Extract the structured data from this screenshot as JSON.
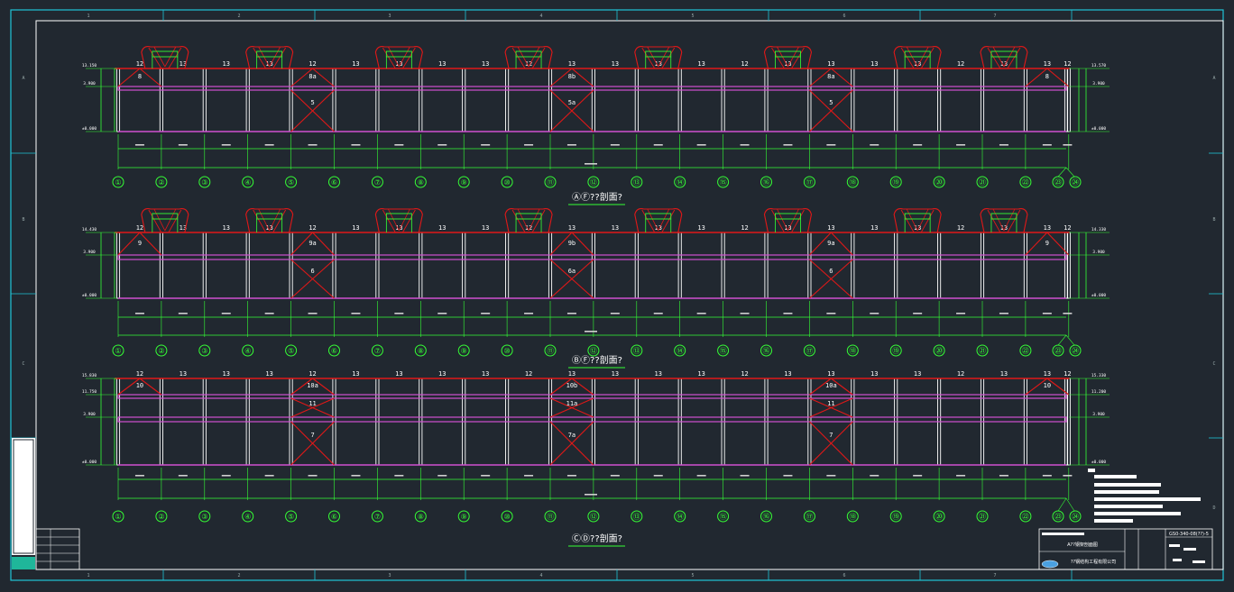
{
  "sections": [
    {
      "key": "af",
      "title": "ⒶⒻ??剖面?",
      "top_codes": [
        "12",
        "13",
        "13",
        "13",
        "12",
        "13",
        "13",
        "13",
        "13",
        "12",
        "13",
        "13",
        "13",
        "13",
        "12",
        "13",
        "13",
        "13",
        "13",
        "12",
        "13",
        "13",
        "12"
      ],
      "braces": [
        {
          "bay": 1,
          "top": "8"
        },
        {
          "bay": 5,
          "top": "8a",
          "bottom": "5"
        },
        {
          "bay": 11,
          "top": "8b",
          "bottom": "5a"
        },
        {
          "bay": 17,
          "top": "8a",
          "bottom": "5"
        },
        {
          "bay": 22,
          "top": "8"
        }
      ],
      "left_elevations": [
        "13.150",
        "3.900",
        "±0.000"
      ],
      "right_elevations": [
        "13.570",
        "3.900",
        "±0.000"
      ],
      "grid_labels": [
        "①",
        "②",
        "③",
        "④",
        "⑤",
        "⑥",
        "⑦",
        "⑧",
        "⑨",
        "⑩",
        "⑪",
        "⑫",
        "⑬",
        "⑭",
        "⑮",
        "⑯",
        "⑰",
        "⑱",
        "⑲",
        "⑳",
        "㉑",
        "㉒",
        "㉓",
        "㉔"
      ]
    },
    {
      "key": "bf",
      "title": "ⒷⒻ??剖面?",
      "top_codes": [
        "12",
        "13",
        "13",
        "13",
        "12",
        "13",
        "13",
        "13",
        "13",
        "12",
        "13",
        "13",
        "13",
        "13",
        "12",
        "13",
        "13",
        "13",
        "13",
        "12",
        "13",
        "13",
        "12"
      ],
      "braces": [
        {
          "bay": 1,
          "top": "9"
        },
        {
          "bay": 5,
          "top": "9a",
          "bottom": "6"
        },
        {
          "bay": 11,
          "top": "9b",
          "bottom": "6a"
        },
        {
          "bay": 17,
          "top": "9a",
          "bottom": "6"
        },
        {
          "bay": 22,
          "top": "9"
        }
      ],
      "left_elevations": [
        "14.430",
        "3.900",
        "±0.000"
      ],
      "right_elevations": [
        "14.330",
        "3.900",
        "±0.000"
      ],
      "grid_labels": [
        "①",
        "②",
        "③",
        "④",
        "⑤",
        "⑥",
        "⑦",
        "⑧",
        "⑨",
        "⑩",
        "⑪",
        "⑫",
        "⑬",
        "⑭",
        "⑮",
        "⑯",
        "⑰",
        "⑱",
        "⑲",
        "⑳",
        "㉑",
        "㉒",
        "㉓",
        "㉔"
      ]
    },
    {
      "key": "cd",
      "title": "ⒸⒹ??剖面?",
      "top_codes": [
        "12",
        "13",
        "13",
        "13",
        "12",
        "13",
        "13",
        "13",
        "13",
        "12",
        "13",
        "13",
        "13",
        "13",
        "12",
        "13",
        "13",
        "13",
        "13",
        "12",
        "13",
        "13",
        "12"
      ],
      "braces": [
        {
          "bay": 1,
          "top": "10"
        },
        {
          "bay": 5,
          "top": "10a",
          "mid": "11",
          "bottom": "7"
        },
        {
          "bay": 11,
          "top": "10b",
          "mid": "11a",
          "bottom": "7a"
        },
        {
          "bay": 17,
          "top": "10a",
          "mid": "11",
          "bottom": "7"
        },
        {
          "bay": 22,
          "top": "10"
        }
      ],
      "left_elevations": [
        "15.830",
        "11.750",
        "3.900",
        "±0.000"
      ],
      "right_elevations": [
        "15.330",
        "11.200",
        "3.900",
        "±0.000"
      ],
      "grid_labels": [
        "①",
        "②",
        "③",
        "④",
        "⑤",
        "⑥",
        "⑦",
        "⑧",
        "⑨",
        "⑩",
        "⑪",
        "⑫",
        "⑬",
        "⑭",
        "⑮",
        "⑯",
        "⑰",
        "⑱",
        "⑲",
        "⑳",
        "㉑",
        "㉒",
        "㉓",
        "㉔"
      ]
    }
  ],
  "border_numbers": [
    "1",
    "2",
    "3",
    "4",
    "5",
    "6",
    "7"
  ],
  "border_letters": [
    "A",
    "B",
    "C",
    "D"
  ],
  "title_block": {
    "title": "A??钢架剖面图",
    "company": "??钢结构工程有限公司",
    "drawing_no": "GS0-340-08(??)-5"
  },
  "colors": {
    "background": "#212830",
    "frame": "#21c4d6",
    "rafter": "#e01818",
    "brace": "#e01818",
    "column": "#ffffff",
    "purlin": "#d050d0",
    "dimension": "#35ff35"
  }
}
